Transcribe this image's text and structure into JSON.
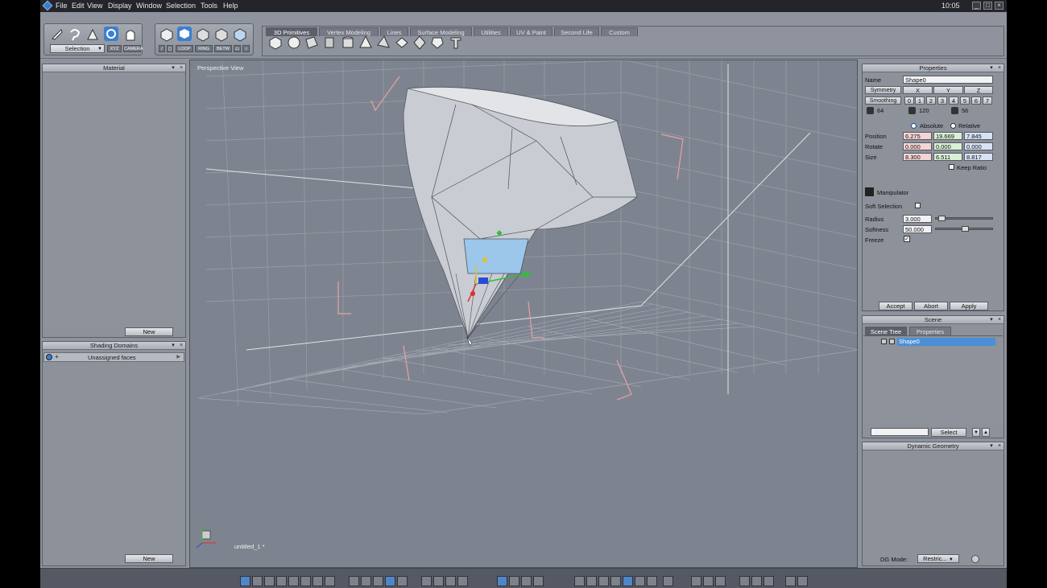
{
  "menubar": {
    "items": [
      "File",
      "Edit",
      "View",
      "Display",
      "Window",
      "Selection",
      "Tools",
      "Help"
    ],
    "clock": "10:05"
  },
  "toolbar": {
    "selection_mode": "Selection",
    "small_buttons": [
      "XYZ",
      "CAMERA",
      "LOOP",
      "RING",
      "BETW"
    ]
  },
  "tabs": [
    "3D Primitives",
    "Vertex Modeling",
    "Lines",
    "Surface Modeling",
    "Utilities",
    "UV & Paint",
    "Second Life",
    "Custom"
  ],
  "material_panel": {
    "title": "Material",
    "new_label": "New"
  },
  "shading_panel": {
    "title": "Shading Domains",
    "item": "Unassigned faces",
    "new_label": "New"
  },
  "viewport": {
    "label": "Perspective View",
    "doc": "untitled_1 *"
  },
  "properties": {
    "title": "Properties",
    "name_label": "Name",
    "name_value": "Shape0",
    "symmetry_label": "Symmetry",
    "axes": [
      "X",
      "Y",
      "Z"
    ],
    "smoothing_label": "Smoothing",
    "smoothing_levels": [
      "0",
      "1",
      "2",
      "3",
      "4",
      "5",
      "6",
      "7"
    ],
    "counts": [
      "64",
      "120",
      "56"
    ],
    "absolute": "Absolute",
    "relative": "Relative",
    "rows": [
      {
        "label": "Position",
        "v": [
          "6.275",
          "19.669",
          "7.845"
        ]
      },
      {
        "label": "Rotate",
        "v": [
          "0.000",
          "0.000",
          "0.000"
        ]
      },
      {
        "label": "Size",
        "v": [
          "8.300",
          "6.511",
          "8.817"
        ]
      }
    ],
    "keep_ratio": "Keep Ratio",
    "manipulator": "Manipulator",
    "soft_selection": "Soft Selection",
    "radius_label": "Radius",
    "radius_value": "3.000",
    "radius_level": 0.05,
    "softness_label": "Softness",
    "softness_value": "50.000",
    "softness_level": 0.5,
    "freeze_label": "Freeze",
    "accept": "Accept",
    "abort": "Abort",
    "apply": "Apply"
  },
  "scene": {
    "title": "Scene",
    "tabs": [
      "Scene Tree",
      "Properties"
    ],
    "item": "Shape0",
    "select_label": "Select"
  },
  "dynamic": {
    "title": "Dynamic Geometry",
    "dg_mode_label": "DG Mode:",
    "dg_mode_value": "Restric..."
  },
  "colors": {
    "accent": "#4a8fd6",
    "x_axis": "#e0302a",
    "y_axis": "#2fbf3a",
    "z_axis": "#2a49d6",
    "selection": "#9cc6ea"
  }
}
